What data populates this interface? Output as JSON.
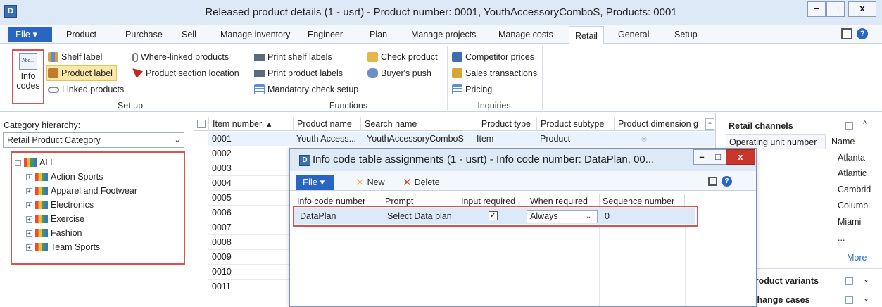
{
  "window": {
    "title": "Released product details (1 - usrt) - Product number: 0001, YouthAccessoryComboS, Products: 0001",
    "minimize": "–",
    "maximize": "□",
    "close": "x"
  },
  "ribbon": {
    "file_label": "File",
    "tabs": [
      "Product",
      "Purchase",
      "Sell",
      "Manage inventory",
      "Engineer",
      "Plan",
      "Manage projects",
      "Manage costs",
      "Retail",
      "General",
      "Setup"
    ],
    "active_tab": "Retail",
    "setup": {
      "group_label": "Set up",
      "info_codes": "Info codes",
      "info_codes_icon_text": "Abc...",
      "shelf_label": "Shelf label",
      "product_label": "Product label",
      "linked_products": "Linked products",
      "where_linked_products": "Where-linked products",
      "product_section_location": "Product section location"
    },
    "functions": {
      "group_label": "Functions",
      "print_shelf_labels": "Print shelf labels",
      "print_product_labels": "Print product labels",
      "mandatory_check_setup": "Mandatory check setup",
      "check_product": "Check product",
      "buyers_push": "Buyer's push"
    },
    "inquiries": {
      "group_label": "Inquiries",
      "competitor_prices": "Competitor prices",
      "sales_transactions": "Sales transactions",
      "pricing": "Pricing"
    }
  },
  "category": {
    "label": "Category hierarchy:",
    "selected": "Retail Product Category",
    "tree": {
      "root": "ALL",
      "items": [
        "Action Sports",
        "Apparel and Footwear",
        "Electronics",
        "Exercise",
        "Fashion",
        "Team Sports"
      ]
    }
  },
  "grid": {
    "columns": [
      "Item number",
      "Product name",
      "Search name",
      "Product type",
      "Product subtype",
      "Product dimension g"
    ],
    "first_row": {
      "item": "0001",
      "name": "Youth Access...",
      "search": "YouthAccessoryComboS",
      "type": "Item",
      "subtype": "Product"
    },
    "item_numbers": [
      "0001",
      "0002",
      "0003",
      "0004",
      "0005",
      "0006",
      "0007",
      "0008",
      "0009",
      "0010",
      "0011"
    ]
  },
  "right_pane": {
    "title": "Retail channels",
    "col_operating": "Operating unit number",
    "col_name": "Name",
    "names": [
      "Atlanta",
      "Atlantic",
      "Cambrid",
      "Columbi",
      "Miami",
      "..."
    ],
    "more": "More",
    "section2": "d product variants",
    "section3": "ct change cases"
  },
  "dialog": {
    "title": "Info code table assignments (1 - usrt) - Info code number: DataPlan, 00...",
    "minimize": "–",
    "maximize": "□",
    "close": "x",
    "file_label": "File",
    "new_label": "New",
    "delete_label": "Delete",
    "columns": [
      "Info code number",
      "Prompt",
      "Input required",
      "When required",
      "Sequence number"
    ],
    "row": {
      "code": "DataPlan",
      "prompt": "Select Data plan",
      "input_required_mark": "✓",
      "when_required": "Always",
      "sequence": "0"
    }
  }
}
